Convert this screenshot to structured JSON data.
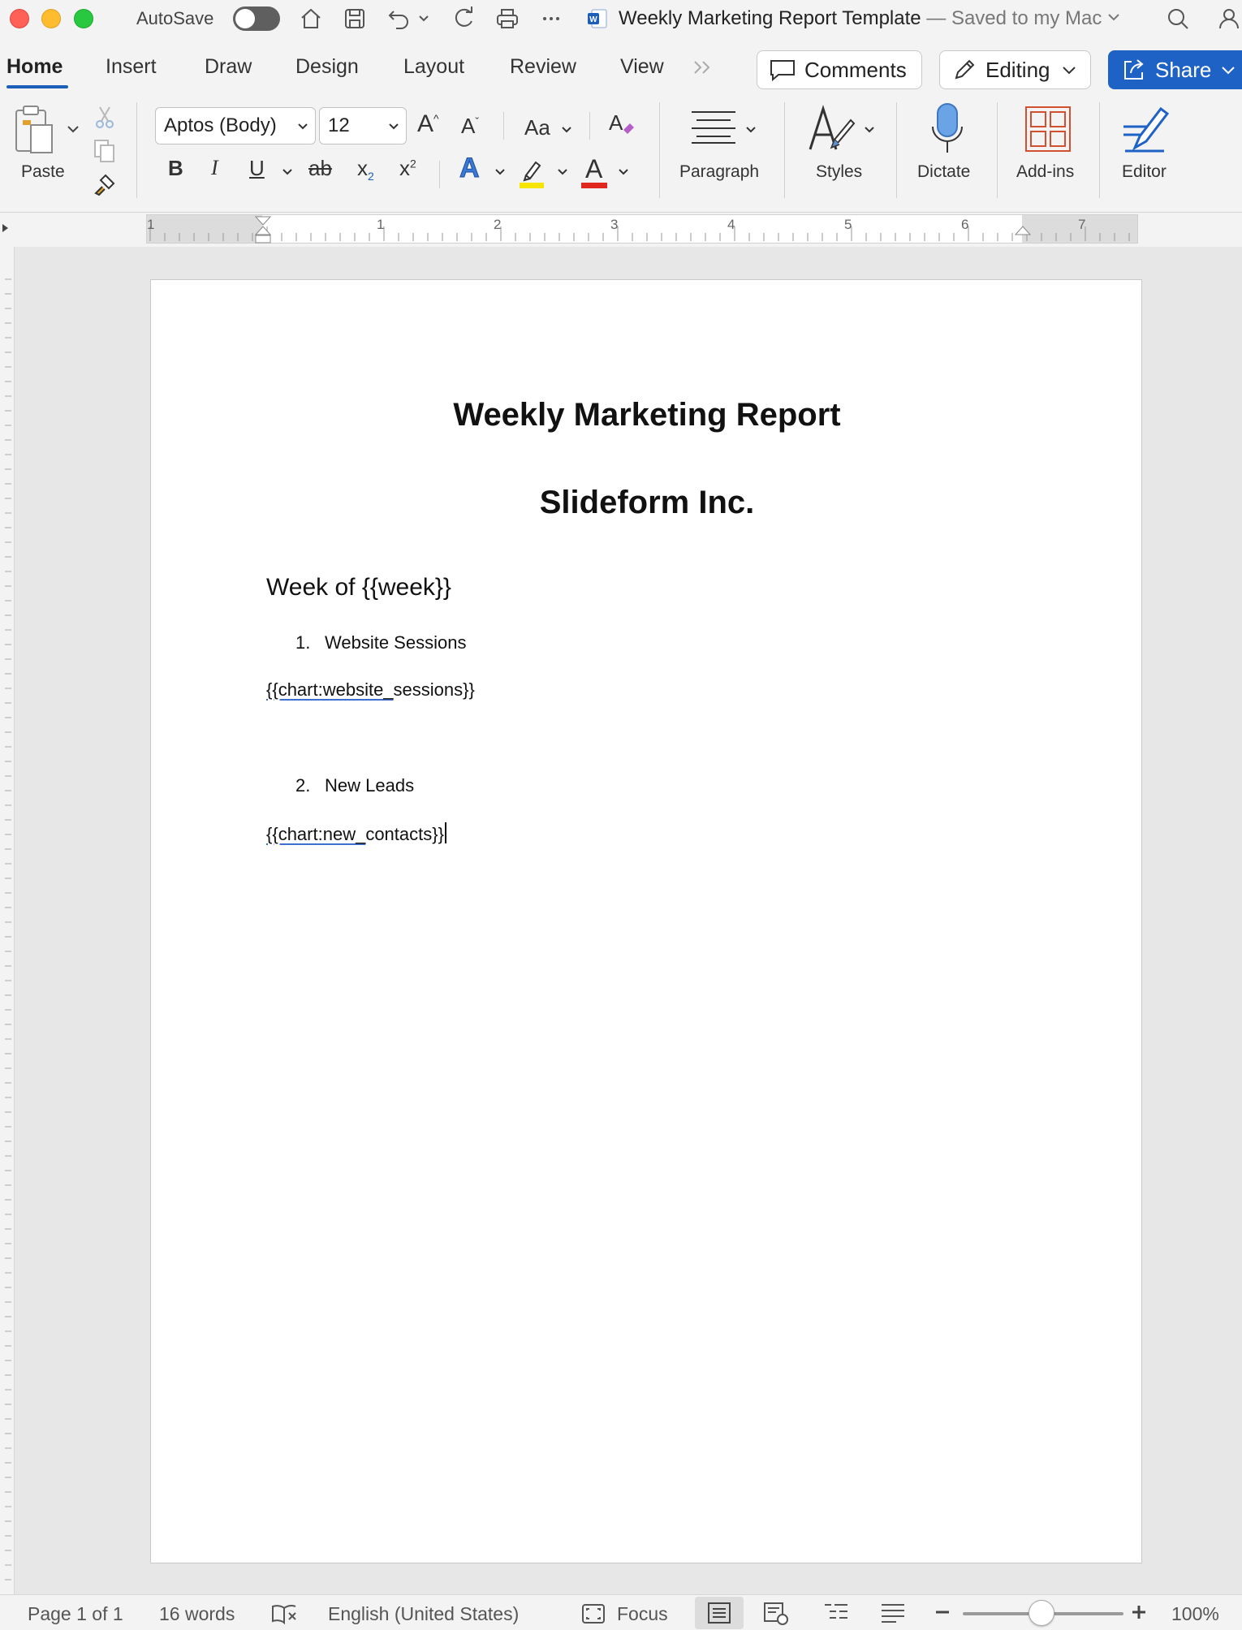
{
  "titlebar": {
    "autosave_label": "AutoSave",
    "doc_name": "Weekly Marketing Report Template",
    "doc_status": "— Saved to my Mac"
  },
  "tabs": {
    "items": [
      "Home",
      "Insert",
      "Draw",
      "Design",
      "Layout",
      "Review",
      "View"
    ],
    "active": "Home",
    "comments_label": "Comments",
    "editing_label": "Editing",
    "share_label": "Share"
  },
  "ribbon": {
    "paste_label": "Paste",
    "font_name": "Aptos (Body)",
    "font_size": "12",
    "case_label": "Aa",
    "paragraph_label": "Paragraph",
    "styles_label": "Styles",
    "dictate_label": "Dictate",
    "addins_label": "Add-ins",
    "editor_label": "Editor",
    "bold": "B",
    "italic": "I",
    "underline": "U",
    "strike": "ab",
    "subscript": "x",
    "superscript": "x",
    "text_effects": "A",
    "font_color": "A",
    "grow_font": "A",
    "shrink_font": "A"
  },
  "ruler": {
    "numbers": [
      "1",
      "1",
      "2",
      "3",
      "4",
      "5",
      "6",
      "7"
    ]
  },
  "document": {
    "title": "Weekly Marketing Report",
    "subtitle": "Slideform Inc.",
    "week_line": "Week of {{week}}",
    "item1_num": "1.",
    "item1": "Website Sessions",
    "chart1_underlined": "{{chart:website_",
    "chart1_rest": "sessions}}",
    "item2_num": "2.",
    "item2": "New Leads",
    "chart2_underlined": "{{chart:new_",
    "chart2_rest": "contacts}}"
  },
  "statusbar": {
    "page": "Page 1 of 1",
    "words": "16 words",
    "language": "English (United States)",
    "focus": "Focus",
    "zoom": "100%"
  },
  "colors": {
    "accent": "#1f62c6",
    "close": "#fe5f57",
    "minimize": "#febc2e",
    "maximize": "#28c840",
    "highlight": "#f5e500",
    "font_color_bar": "#e0281e",
    "addins": "#d24f2f"
  }
}
